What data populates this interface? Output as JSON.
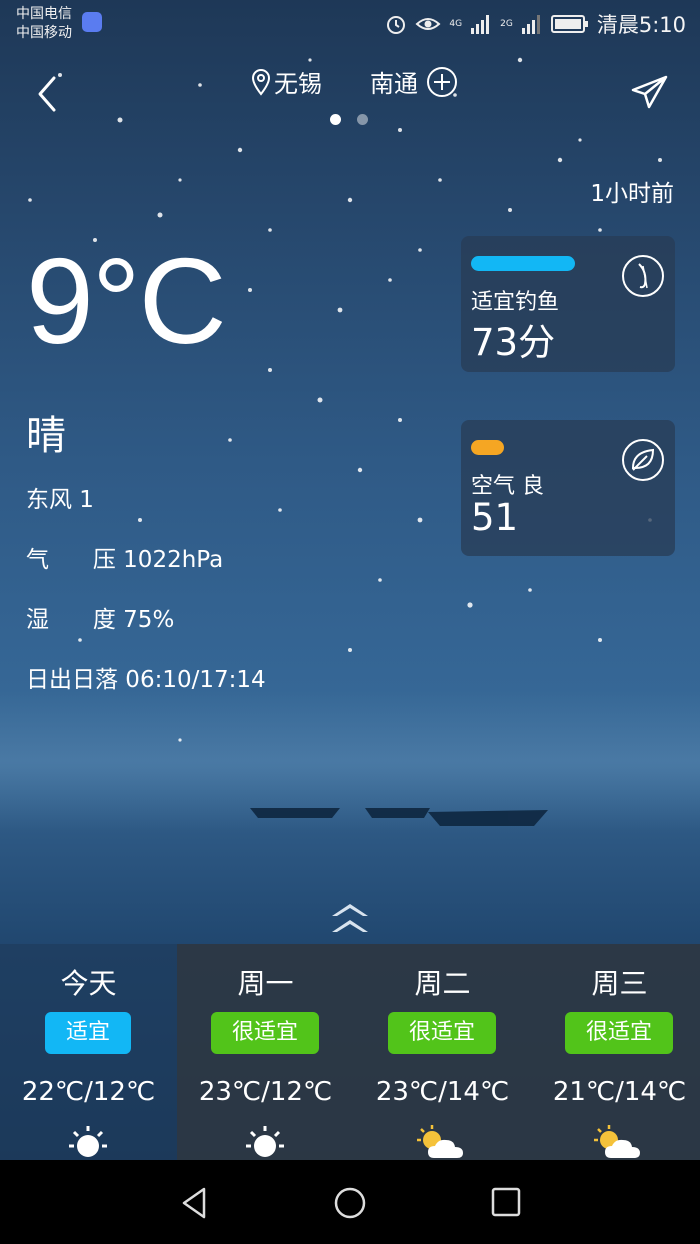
{
  "status_bar": {
    "carrier_1": "中国电信",
    "carrier_2": "中国移动",
    "network_1": "4G",
    "network_2": "2G",
    "time": "清晨5:10",
    "icons": [
      "music-app-icon",
      "alarm-icon",
      "eye-icon",
      "signal-icon",
      "battery-icon"
    ]
  },
  "header": {
    "current_city": "无锡",
    "other_city": "南通",
    "icons": [
      "back-icon",
      "location-pin-icon",
      "add-city-icon",
      "share-icon"
    ],
    "page_count": 2,
    "active_page": 0
  },
  "weather": {
    "updated": "1小时前",
    "temperature": "9°C",
    "condition": "晴",
    "wind": "东风 1",
    "pressure": "气      压 1022hPa",
    "humidity": "湿      度 75%",
    "sunrise_sunset": "日出日落 06:10/17:14"
  },
  "cards": {
    "fishing": {
      "label": "适宜钓鱼",
      "value": "73分",
      "bar_color": "#12b7f5",
      "icon": "fishing-icon"
    },
    "air": {
      "label": "空气 良",
      "value": "51",
      "bar_color": "#f5a623",
      "icon": "leaf-icon"
    }
  },
  "forecast": [
    {
      "day": "今天",
      "badge": "适宜",
      "badge_color": "#12b7f5",
      "temp": "22℃/12℃",
      "icon": "sun-icon"
    },
    {
      "day": "周一",
      "badge": "很适宜",
      "badge_color": "#52c41a",
      "temp": "23℃/12℃",
      "icon": "sun-icon"
    },
    {
      "day": "周二",
      "badge": "很适宜",
      "badge_color": "#52c41a",
      "temp": "23℃/14℃",
      "icon": "partly-cloudy-icon"
    },
    {
      "day": "周三",
      "badge": "很适宜",
      "badge_color": "#52c41a",
      "temp": "21℃/14℃",
      "icon": "partly-cloudy-icon"
    }
  ]
}
